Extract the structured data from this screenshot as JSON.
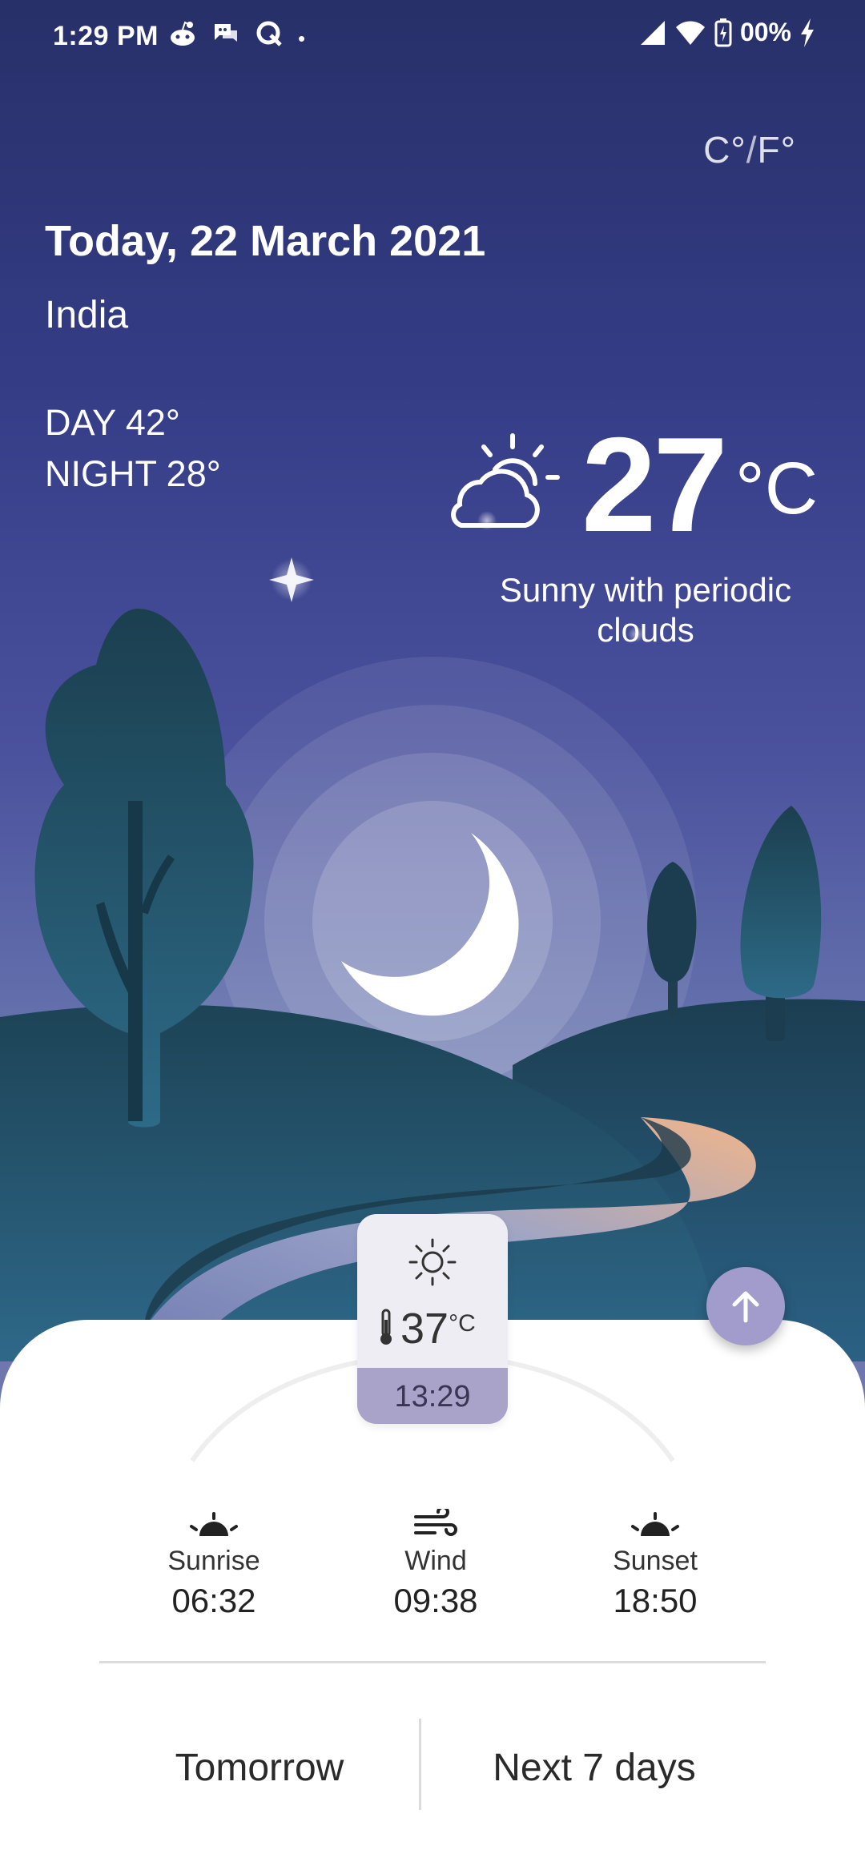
{
  "status_bar": {
    "time": "1:29 PM",
    "notification_icons": [
      "reddit-icon",
      "chat-icon",
      "q-app-icon"
    ],
    "dot": "•",
    "battery_text": "00%"
  },
  "header": {
    "unit_c": "C°",
    "unit_sep": "/",
    "unit_f": "F°",
    "date": "Today, 22 March 2021",
    "location": "India",
    "day_temp": "DAY 42°",
    "night_temp": "NIGHT 28°"
  },
  "current": {
    "temp": "27",
    "unit": "°C",
    "condition": "Sunny with periodic clouds",
    "icon": "partly-cloudy-icon"
  },
  "now_card": {
    "icon": "sun-icon",
    "temp": "37",
    "unit": "°C",
    "time": "13:29"
  },
  "stats": [
    {
      "label": "Sunrise",
      "value": "06:32",
      "icon": "sunrise-icon"
    },
    {
      "label": "Wind",
      "value": "09:38",
      "icon": "wind-icon"
    },
    {
      "label": "Sunset",
      "value": "18:50",
      "icon": "sunset-icon"
    }
  ],
  "tabs": {
    "tomorrow": "Tomorrow",
    "next7": "Next 7 days"
  },
  "colors": {
    "sky_top": "#283069",
    "sky_mid": "#4a519d",
    "hill_dark": "#1d4356",
    "hill_mid": "#235069",
    "path_light": "#e9b08a",
    "accent": "#a19ccb"
  }
}
